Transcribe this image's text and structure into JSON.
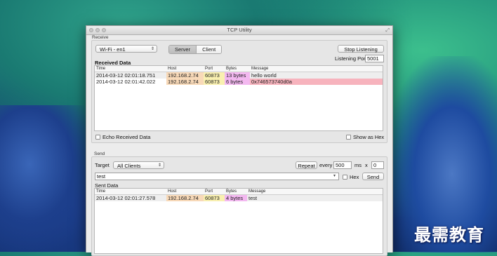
{
  "window": {
    "title": "TCP Utility"
  },
  "receive": {
    "section_label": "Receive",
    "interface": "Wi-Fi - en1",
    "mode_server": "Server",
    "mode_client": "Client",
    "stop_label": "Stop Listening",
    "port_label": "Listening Port",
    "port_value": "5001",
    "received_title": "Received Data",
    "columns": [
      "Time",
      "Host",
      "Port",
      "Bytes",
      "Message"
    ],
    "rows": [
      {
        "time": "2014-03-12 02:01:18.751",
        "host": "192.168.2.74",
        "port": "60873",
        "bytes": "13 bytes",
        "message": "hello world"
      },
      {
        "time": "2014-03-12 02:01:42.022",
        "host": "192.168.2.74",
        "port": "60873",
        "bytes": "6 bytes",
        "message": "0x746573740d0a"
      }
    ],
    "echo_label": "Echo Received Data",
    "hex_label": "Show as Hex"
  },
  "send": {
    "section_label": "Send",
    "target_label": "Target",
    "target_value": "All Clients",
    "repeat_label": "Repeat",
    "every_label": "every",
    "every_value": "500",
    "ms_label": "ms",
    "x_label": "x",
    "count_value": "0",
    "message_value": "test",
    "hex_label": "Hex",
    "send_label": "Send",
    "sent_title": "Sent Data",
    "columns": [
      "Time",
      "Host",
      "Port",
      "Bytes",
      "Message"
    ],
    "rows": [
      {
        "time": "2014-03-12 02:01:27.578",
        "host": "192.168.2.74",
        "port": "60873",
        "bytes": "4 bytes",
        "message": "test"
      }
    ]
  },
  "colors": {
    "host_cell": "#f8d9b8",
    "port_cell": "#f9f0b0",
    "bytes_cell": "#f3b8f0",
    "hex_message_cell": "#f7b3bd"
  },
  "watermark": "最需教育"
}
